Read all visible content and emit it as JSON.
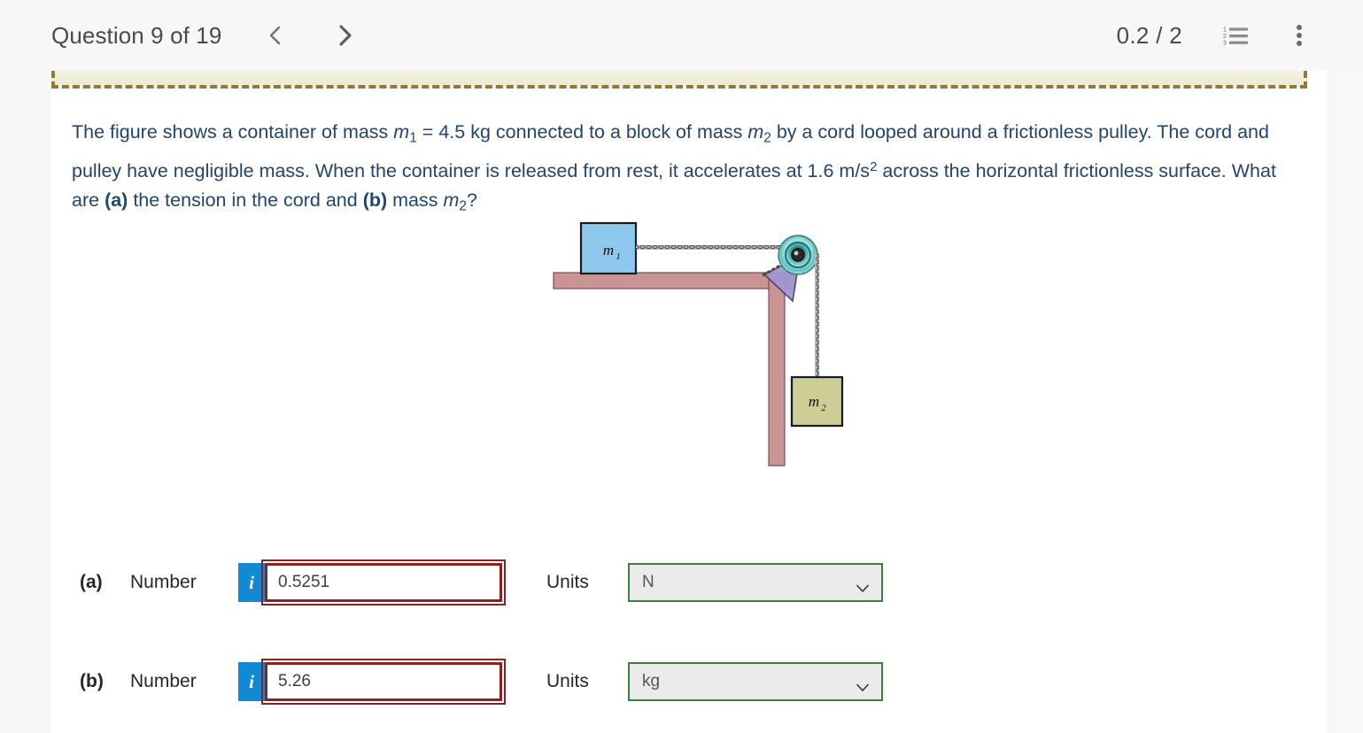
{
  "header": {
    "question_title": "Question 9 of 19",
    "prev_icon": "chevron-left-icon",
    "next_icon": "chevron-right-icon",
    "score": "0.2 / 2",
    "list_icon": "numbered-list-icon",
    "menu_icon": "kebab-menu-icon"
  },
  "question": {
    "seg1": "The figure shows a container of mass ",
    "m1": "m",
    "m1_sub": "1",
    "seg2": " = 4.5 kg connected to a block of mass ",
    "m2": "m",
    "m2_sub": "2",
    "seg3": " by a cord looped around a frictionless pulley. The cord and pulley have negligible mass. When the container is released from rest, it accelerates at 1.6 m/s",
    "exp": "2",
    "seg4": " across the horizontal frictionless surface. What are ",
    "parta": "(a)",
    "seg5": " the tension in the cord and ",
    "partb": "(b)",
    "seg6": " mass ",
    "m2b": "m",
    "m2b_sub": "2",
    "seg7": "?"
  },
  "figure": {
    "block1_label": "m",
    "block1_sub": "1",
    "block2_label": "m",
    "block2_sub": "2",
    "colors": {
      "block1": "#8fc8ef",
      "block2": "#cdcd96",
      "surface": "#c99494",
      "pulley": "#7fd0cc",
      "bracket": "#9f97d4",
      "cord": "#8d8d8d"
    }
  },
  "answers": [
    {
      "part": "(a)",
      "number_label": "Number",
      "info_icon": "info-icon",
      "info_label": "i",
      "value": "0.5251",
      "units_label": "Units",
      "unit_value": "N",
      "caret_icon": "chevron-down-icon",
      "input_state": "incorrect",
      "select_state": "correct"
    },
    {
      "part": "(b)",
      "number_label": "Number",
      "info_icon": "info-icon",
      "info_label": "i",
      "value": "5.26",
      "units_label": "Units",
      "unit_value": "kg",
      "caret_icon": "chevron-down-icon",
      "input_state": "incorrect",
      "select_state": "correct"
    }
  ],
  "theme": {
    "header_bg": "#f7f7f7",
    "banner_bg": "#efeeda",
    "banner_dash": "#937a33",
    "info_blue": "#1289d4",
    "error_red": "#8b2220",
    "ok_green": "#3f7d3f",
    "text_blue": "#21456e"
  }
}
